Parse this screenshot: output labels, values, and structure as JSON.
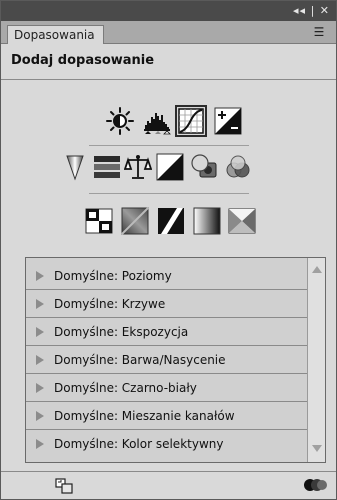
{
  "window": {
    "controls_glyphs": "◂◂ | ✕"
  },
  "tabs": [
    {
      "label": "Dopasowania"
    }
  ],
  "header": {
    "title": "Dodaj dopasowanie"
  },
  "adjustment_icons": {
    "row1": [
      "brightness-contrast-icon",
      "levels-icon",
      "curves-icon",
      "exposure-icon"
    ],
    "row2": [
      "vibrance-icon",
      "hue-saturation-icon",
      "color-balance-icon",
      "black-white-icon",
      "photo-filter-icon",
      "channel-mixer-icon"
    ],
    "row3": [
      "invert-icon",
      "posterize-icon",
      "threshold-icon",
      "gradient-map-icon",
      "selective-color-icon"
    ],
    "selected": "curves-icon"
  },
  "preset_list": {
    "items": [
      {
        "label": "Domyślne: Poziomy"
      },
      {
        "label": "Domyślne: Krzywe"
      },
      {
        "label": "Domyślne: Ekspozycja"
      },
      {
        "label": "Domyślne: Barwa/Nasycenie"
      },
      {
        "label": "Domyślne: Czarno-biały"
      },
      {
        "label": "Domyślne: Mieszanie kanałów"
      },
      {
        "label": "Domyślne: Kolor selektywny"
      }
    ]
  },
  "footer": {
    "left_icon": "clip-to-layer-icon",
    "right_icon": "visibility-toggle-icon"
  },
  "colors": {
    "panel_bg": "#d9d9d9",
    "topbar": "#4a4a4a",
    "tabstrip": "#a9a9a9"
  }
}
